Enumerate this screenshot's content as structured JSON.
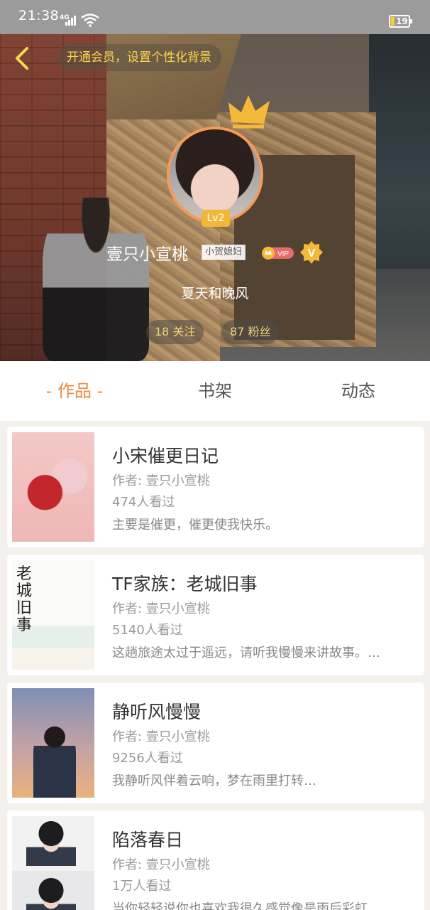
{
  "status_bar": {
    "time": "21:38",
    "network": "4G",
    "battery": "19"
  },
  "header": {
    "vip_hint": "开通会员，设置个性化背景",
    "level": "Lv2",
    "nickname": "壹只小宣桃",
    "nickname_tag": "小贺媳妇",
    "vip_label": "VIP",
    "v_label": "V",
    "signature": "夏天和晚风",
    "following": "18 关注",
    "fans": "87 粉丝"
  },
  "tabs": [
    {
      "label": "- 作品 -",
      "active": true
    },
    {
      "label": "书架",
      "active": false
    },
    {
      "label": "动态",
      "active": false
    }
  ],
  "works": [
    {
      "title": "小宋催更日记",
      "author": "作者: 壹只小宣桃",
      "views": "474人看过",
      "desc": "主要是催更，催更使我快乐。"
    },
    {
      "title": "TF家族：老城旧事",
      "author": "作者: 壹只小宣桃",
      "views": "5140人看过",
      "desc": "这趟旅途太过于遥远，请听我慢慢来讲故事。…"
    },
    {
      "title": "静听风慢慢",
      "author": "作者: 壹只小宣桃",
      "views": "9256人看过",
      "desc": "我静听风伴着云响，梦在雨里打转…"
    },
    {
      "title": "陷落春日",
      "author": "作者: 壹只小宣桃",
      "views": "1万人看过",
      "desc": "当你轻轻说你也喜欢我很久感觉像是雨后彩虹…"
    }
  ],
  "cover2_text": "老城旧事",
  "colors": {
    "accent": "#f08a3c",
    "gold": "#f7d84a",
    "status_bar": "#9b9b9b"
  }
}
